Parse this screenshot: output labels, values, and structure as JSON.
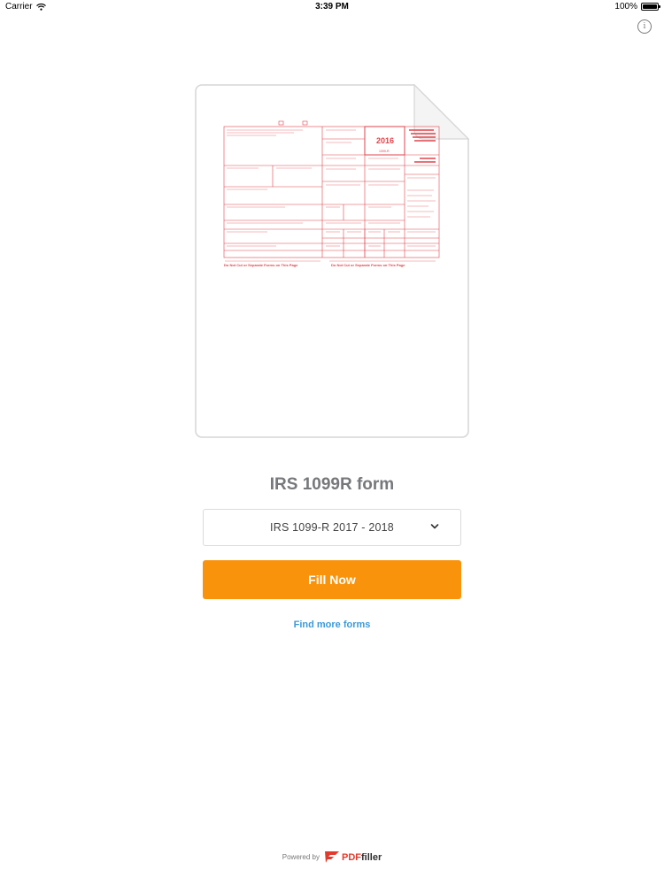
{
  "status_bar": {
    "carrier": "Carrier",
    "time": "3:39 PM",
    "battery": "100%",
    "battery_level": 1.0
  },
  "header": {
    "info_icon": "info-circle-icon"
  },
  "form": {
    "title": "IRS 1099R form",
    "version_selected": "IRS 1099-R 2017 - 2018",
    "thumb_year": "2016",
    "thumb_form_name": "1099-R",
    "thumb_footer": "Do Not Cut or Separate Forms on This Page"
  },
  "actions": {
    "fill_now": "Fill Now",
    "find_more": "Find more forms"
  },
  "footer": {
    "powered_by": "Powered by",
    "brand": "PDFfiller"
  },
  "colors": {
    "accent_orange": "#f9930b",
    "link_blue": "#3d9ad8",
    "title_gray": "#77787c",
    "form_red": "#e0434b"
  }
}
